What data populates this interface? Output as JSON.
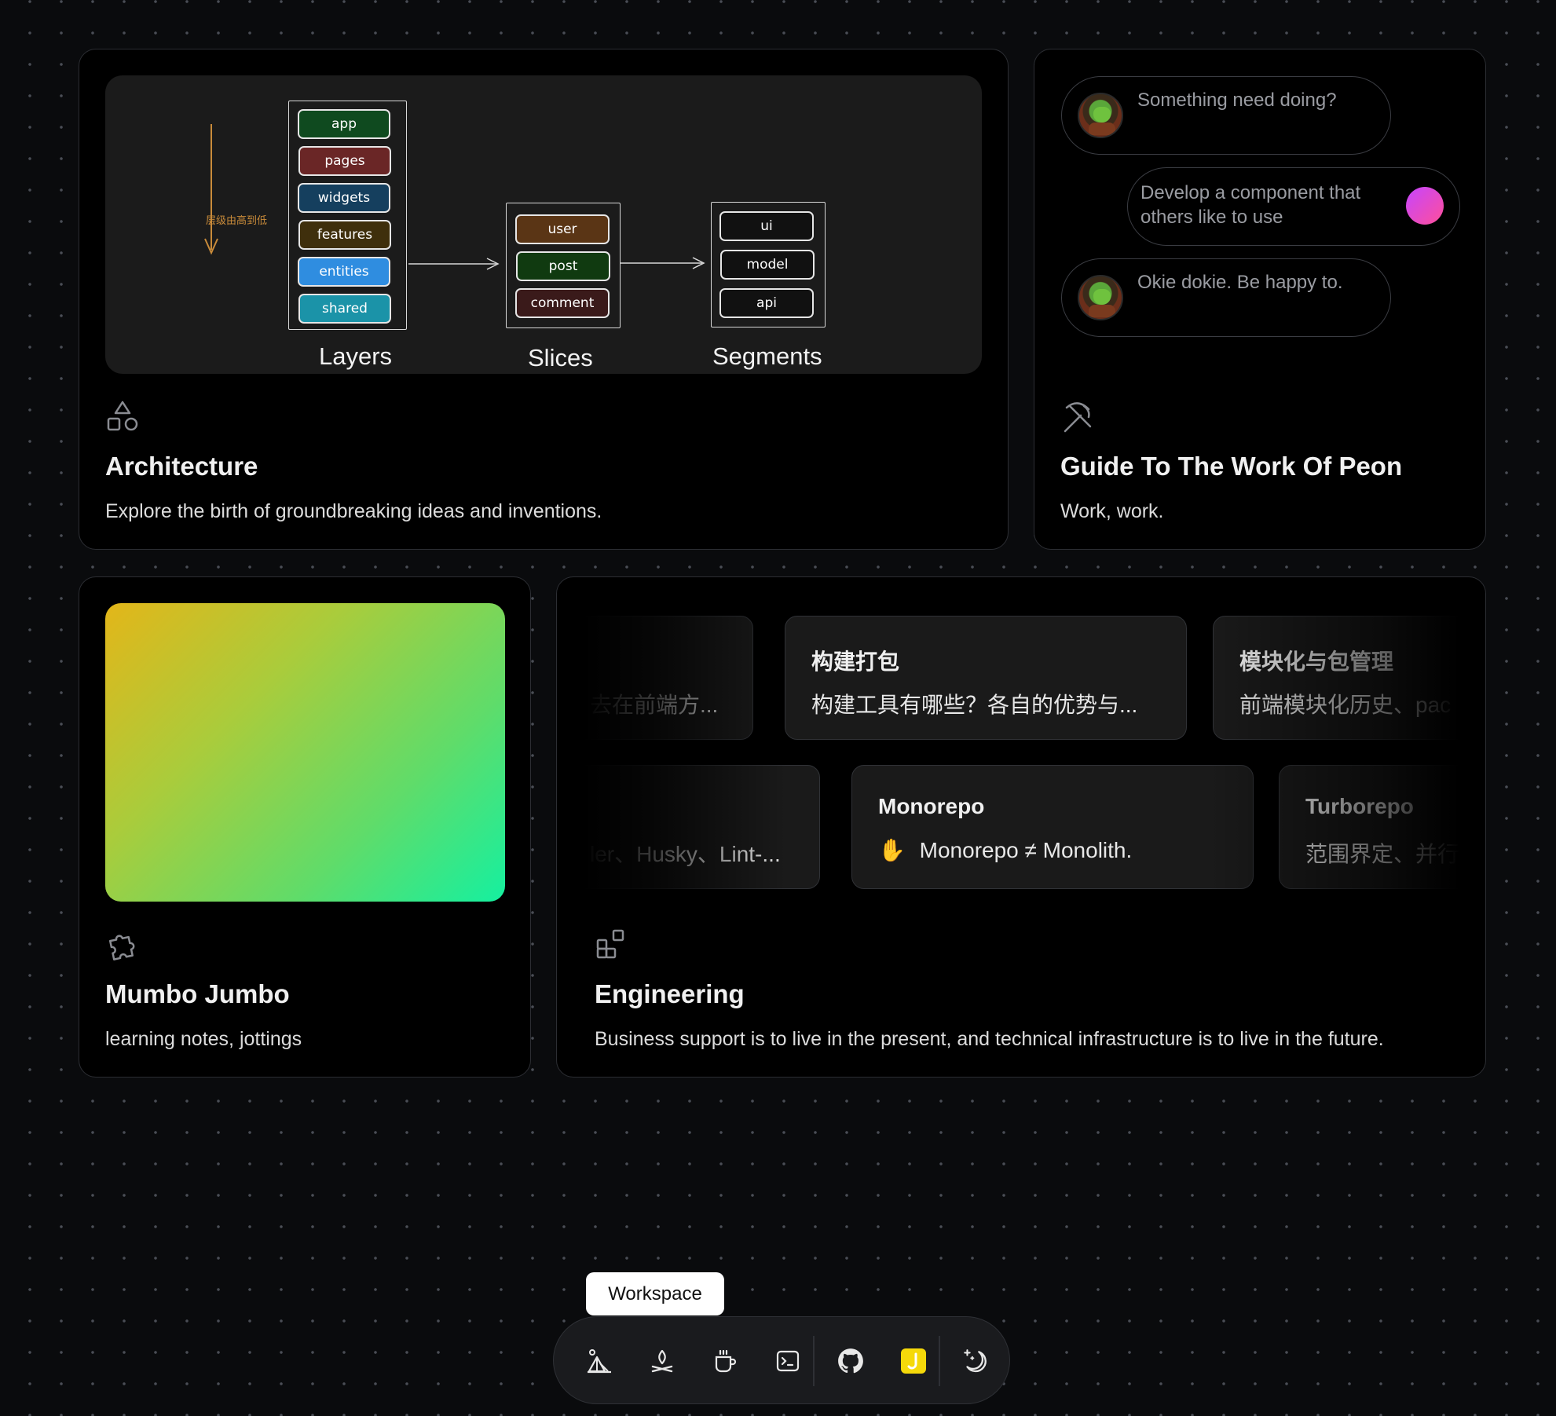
{
  "architecture": {
    "title": "Architecture",
    "description": "Explore the birth of groundbreaking ideas and inventions.",
    "icon": "shapes-icon",
    "diagram": {
      "vertical_label": "层级由高到低",
      "layers_label": "Layers",
      "slices_label": "Slices",
      "segments_label": "Segments",
      "layers": [
        "app",
        "pages",
        "widgets",
        "features",
        "entities",
        "shared"
      ],
      "slices": [
        "user",
        "post",
        "comment"
      ],
      "segments": [
        "ui",
        "model",
        "api"
      ],
      "layer_colors": [
        "#0f4a1f",
        "#6a2626",
        "#153f5e",
        "#3f2f0c",
        "#2f8de0",
        "#1b93a8"
      ],
      "slice_colors": [
        "#5a3515",
        "#103a10",
        "#3a1a1a"
      ],
      "arrow_color": "#c98b3a"
    }
  },
  "peon": {
    "title": "Guide To The Work Of Peon",
    "description": "Work, work.",
    "icon": "pickaxe-icon",
    "messages": [
      {
        "text": "Something need doing?",
        "from": "peon"
      },
      {
        "text": "Develop a component that others like to use",
        "from": "user"
      },
      {
        "text": "Okie dokie. Be happy to.",
        "from": "peon"
      }
    ]
  },
  "mumbo": {
    "title": "Mumbo Jumbo",
    "description": "learning notes, jottings",
    "icon": "puzzle-icon",
    "gradient": [
      "#e3b619",
      "#15f0a0"
    ]
  },
  "engineering": {
    "title": "Engineering",
    "description": "Business support is to live in the present, and technical infrastructure is to live in the future.",
    "icon": "blocks-icon",
    "row1": [
      {
        "title": "",
        "subtitle": "去在前端方..."
      },
      {
        "title": "构建打包",
        "subtitle": "构建工具有哪些？各自的优势与..."
      },
      {
        "title": "模块化与包管理",
        "subtitle": "前端模块化历史、pac"
      }
    ],
    "row2": [
      {
        "title": "",
        "subtitle": "ler、Husky、Lint-..."
      },
      {
        "title": "Monorepo",
        "subtitle": "Monorepo ≠ Monolith."
      },
      {
        "title": "Turborepo",
        "subtitle": "范围界定、并行"
      }
    ],
    "row2_emoji": "✋"
  },
  "dock": {
    "tooltip": "Workspace",
    "items": [
      "workspace-icon",
      "campfire-icon",
      "coffee-icon",
      "terminal-icon",
      "github-icon",
      "juejin-icon",
      "theme-toggle-icon"
    ],
    "accent_yellow": "#f5d90a"
  }
}
